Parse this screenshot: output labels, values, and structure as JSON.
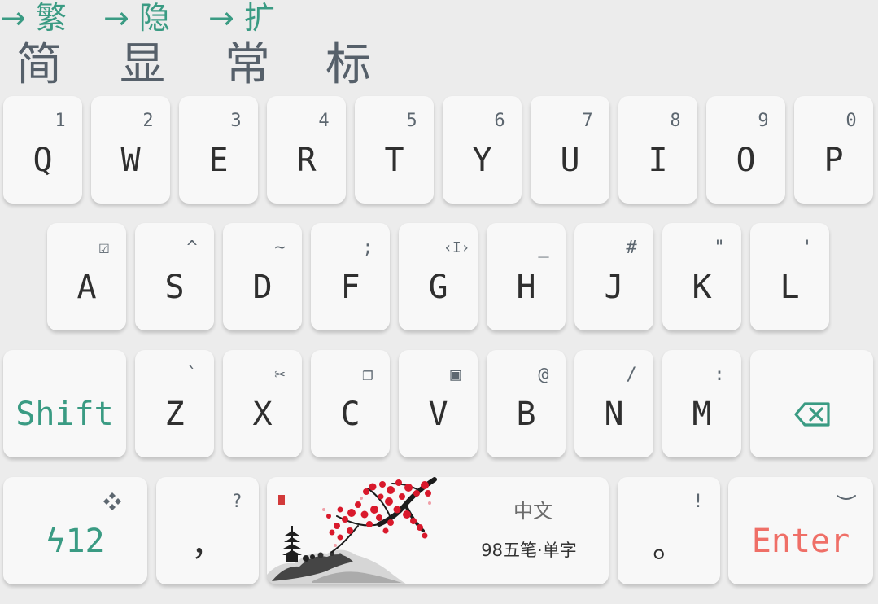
{
  "candidate_bar": {
    "items": [
      {
        "comment": "→ 繁",
        "text": "简"
      },
      {
        "comment": "→ 隐",
        "text": "显"
      },
      {
        "comment": "→ 扩",
        "text": "常"
      },
      {
        "text": "标"
      }
    ]
  },
  "keyboard": {
    "row1": [
      {
        "label": "Q",
        "hint": "1"
      },
      {
        "label": "W",
        "hint": "2"
      },
      {
        "label": "E",
        "hint": "3"
      },
      {
        "label": "R",
        "hint": "4"
      },
      {
        "label": "T",
        "hint": "5"
      },
      {
        "label": "Y",
        "hint": "6"
      },
      {
        "label": "U",
        "hint": "7"
      },
      {
        "label": "I",
        "hint": "8"
      },
      {
        "label": "O",
        "hint": "9"
      },
      {
        "label": "P",
        "hint": "0"
      }
    ],
    "row2": [
      {
        "label": "A",
        "hint": "☑",
        "hint_icon": "checkbox-icon"
      },
      {
        "label": "S",
        "hint": "^"
      },
      {
        "label": "D",
        "hint": "~"
      },
      {
        "label": "F",
        "hint": ";"
      },
      {
        "label": "G",
        "hint": "‹I›",
        "hint_icon": "cursor-icon"
      },
      {
        "label": "H",
        "hint": "_"
      },
      {
        "label": "J",
        "hint": "#"
      },
      {
        "label": "K",
        "hint": "\""
      },
      {
        "label": "L",
        "hint": "'"
      }
    ],
    "row3": {
      "shift_label": "Shift",
      "keys": [
        {
          "label": "Z",
          "hint": "`"
        },
        {
          "label": "X",
          "hint": "✂",
          "hint_icon": "scissors-icon"
        },
        {
          "label": "C",
          "hint": "❐",
          "hint_icon": "copy-icon"
        },
        {
          "label": "V",
          "hint": "▣",
          "hint_icon": "paste-icon"
        },
        {
          "label": "B",
          "hint": "@"
        },
        {
          "label": "N",
          "hint": "/"
        },
        {
          "label": "M",
          "hint": ":"
        }
      ],
      "backspace_icon": "backspace-icon"
    },
    "row4": {
      "symbols_key": {
        "label": "ϟ12",
        "hint_icon": "four-diamonds-icon"
      },
      "comma_key": {
        "label": "，",
        "hint": "?"
      },
      "space_key": {
        "language": "中文",
        "schema": "98五笔·单字",
        "image": "plum-blossom-painting"
      },
      "period_key": {
        "label": "。",
        "hint": "!"
      },
      "enter_key": {
        "label": "Enter",
        "hint_icon": "chevron-down-icon"
      }
    }
  },
  "colors": {
    "background": "#ececec",
    "key": "#f8f8f8",
    "accent_green": "#3a9b83",
    "enter_red": "#ef6f67",
    "candidate_text": "#56606a"
  }
}
